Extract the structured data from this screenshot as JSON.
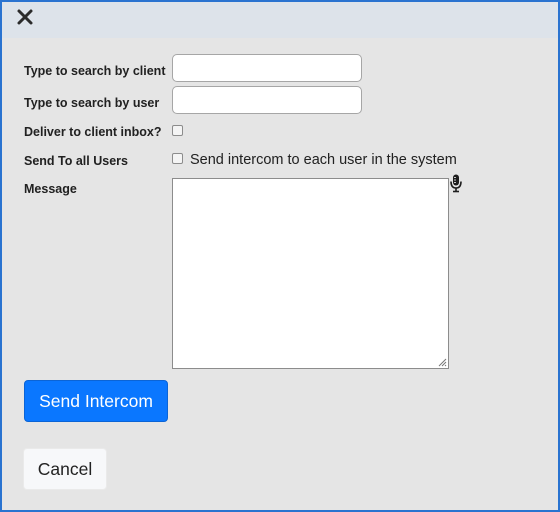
{
  "dialog": {
    "close_icon": "close-icon"
  },
  "form": {
    "client_search_label": "Type to search by client",
    "client_search_value": "",
    "user_search_label": "Type to search by user",
    "user_search_value": "",
    "deliver_inbox_label": "Deliver to client inbox?",
    "deliver_inbox_checked": false,
    "send_all_label": "Send To all Users",
    "send_all_checked": false,
    "send_all_description": "Send intercom to each user in the system",
    "message_label": "Message",
    "message_value": "",
    "mic_icon": "microphone-icon"
  },
  "actions": {
    "send_label": "Send Intercom",
    "cancel_label": "Cancel"
  },
  "colors": {
    "primary": "#0a77ff",
    "frame_border": "#2a73d0",
    "titlebar": "#dde3ea",
    "panel": "#e5e5e5"
  }
}
